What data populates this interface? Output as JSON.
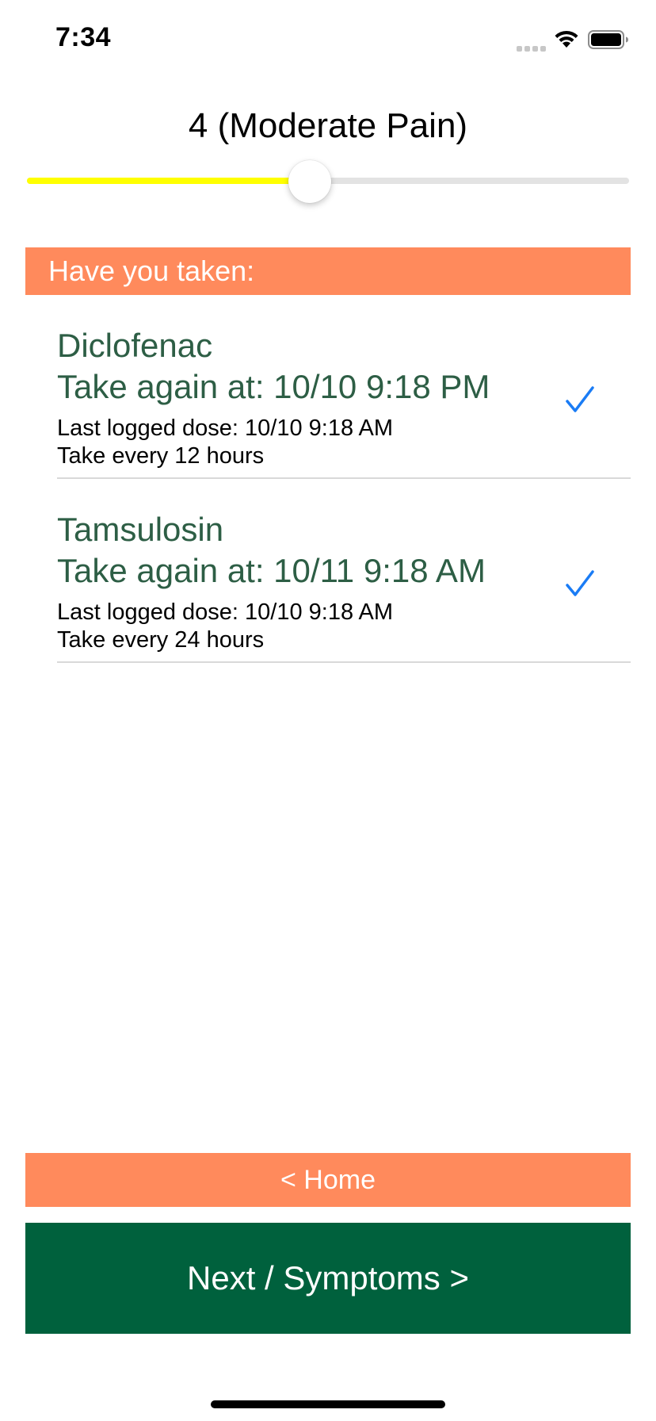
{
  "status_bar": {
    "time": "7:34",
    "icons": [
      "cellular-signal-icon",
      "wifi-icon",
      "battery-icon"
    ]
  },
  "pain": {
    "label": "4 (Moderate Pain)",
    "level": 4,
    "slider_fraction": 0.47,
    "fill_color": "#ffff00"
  },
  "medications": {
    "header": "Have you taken:",
    "items": [
      {
        "name": "Diclofenac",
        "next_dose": "Take again at: 10/10 9:18 PM",
        "last_dose": "Last logged dose: 10/10 9:18 AM",
        "frequency": "Take every 12 hours",
        "checked": true
      },
      {
        "name": "Tamsulosin",
        "next_dose": "Take again at: 10/11 9:18 AM",
        "last_dose": "Last logged dose: 10/10 9:18 AM",
        "frequency": "Take every 24 hours",
        "checked": true
      }
    ]
  },
  "buttons": {
    "home": "< Home",
    "next": "Next / Symptoms >"
  },
  "colors": {
    "accent_orange": "#ff8a5c",
    "primary_green": "#00613d",
    "med_text_green": "#2d5e45",
    "checkmark_blue": "#1a7cf5"
  }
}
